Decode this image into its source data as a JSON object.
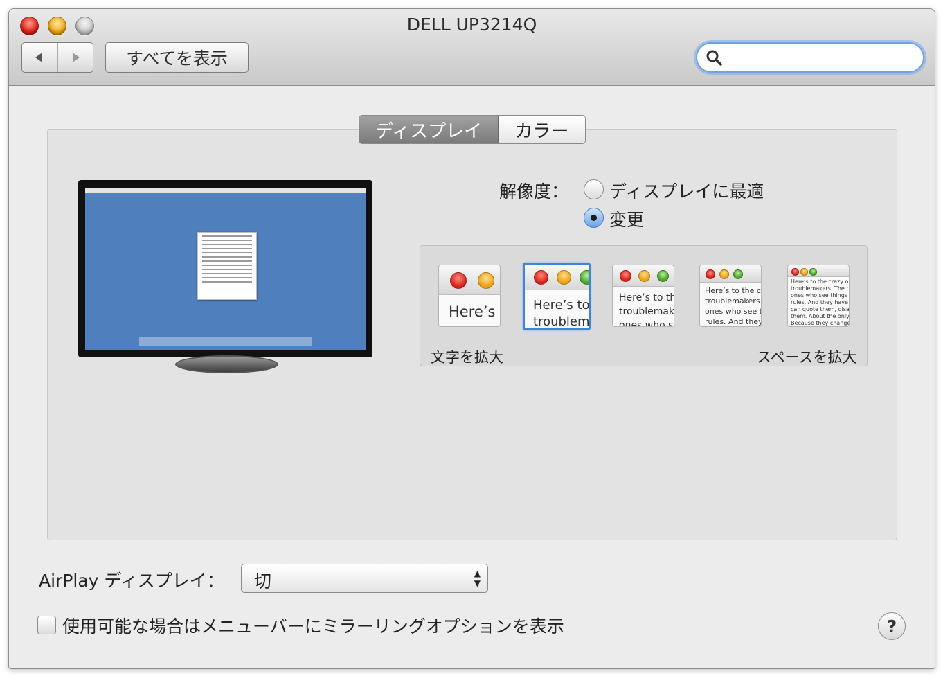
{
  "window": {
    "title": "DELL UP3214Q"
  },
  "toolbar": {
    "back_icon": "back-arrow-icon",
    "forward_icon": "forward-arrow-icon",
    "show_all_label": "すべてを表示",
    "search_placeholder": ""
  },
  "tabs": [
    {
      "label": "ディスプレイ",
      "selected": true
    },
    {
      "label": "カラー",
      "selected": false
    }
  ],
  "resolution": {
    "label": "解像度：",
    "options": [
      {
        "label": "ディスプレイに最適",
        "selected": false
      },
      {
        "label": "変更",
        "selected": true
      }
    ]
  },
  "scaling": {
    "left_label": "文字を拡大",
    "right_label": "スペースを拡大",
    "selected_index": 1,
    "previews": [
      {
        "text": "Here’s"
      },
      {
        "text": "Here’s to\ntroublem"
      },
      {
        "text": "Here’s to th\ntroublemak\nones who s"
      },
      {
        "text": "Here’s to the cr\ntroublemakers.\nones who see t\nrules. And they"
      },
      {
        "text": "Here’s to the crazy ones\ntroublemakers. The rou\nones who see things dif\nrules. And they have no\ncan quote them, disagre\nthem. About the only th\nBecause they change th"
      }
    ]
  },
  "airplay": {
    "label": "AirPlay ディスプレイ：",
    "value": "切"
  },
  "mirroring": {
    "label": "使用可能な場合はメニューバーにミラーリングオプションを表示",
    "checked": false
  },
  "help": {
    "label": "?"
  },
  "colors": {
    "selected_blue": "#3f84d8",
    "desktop_blue": "#4f80bd"
  }
}
